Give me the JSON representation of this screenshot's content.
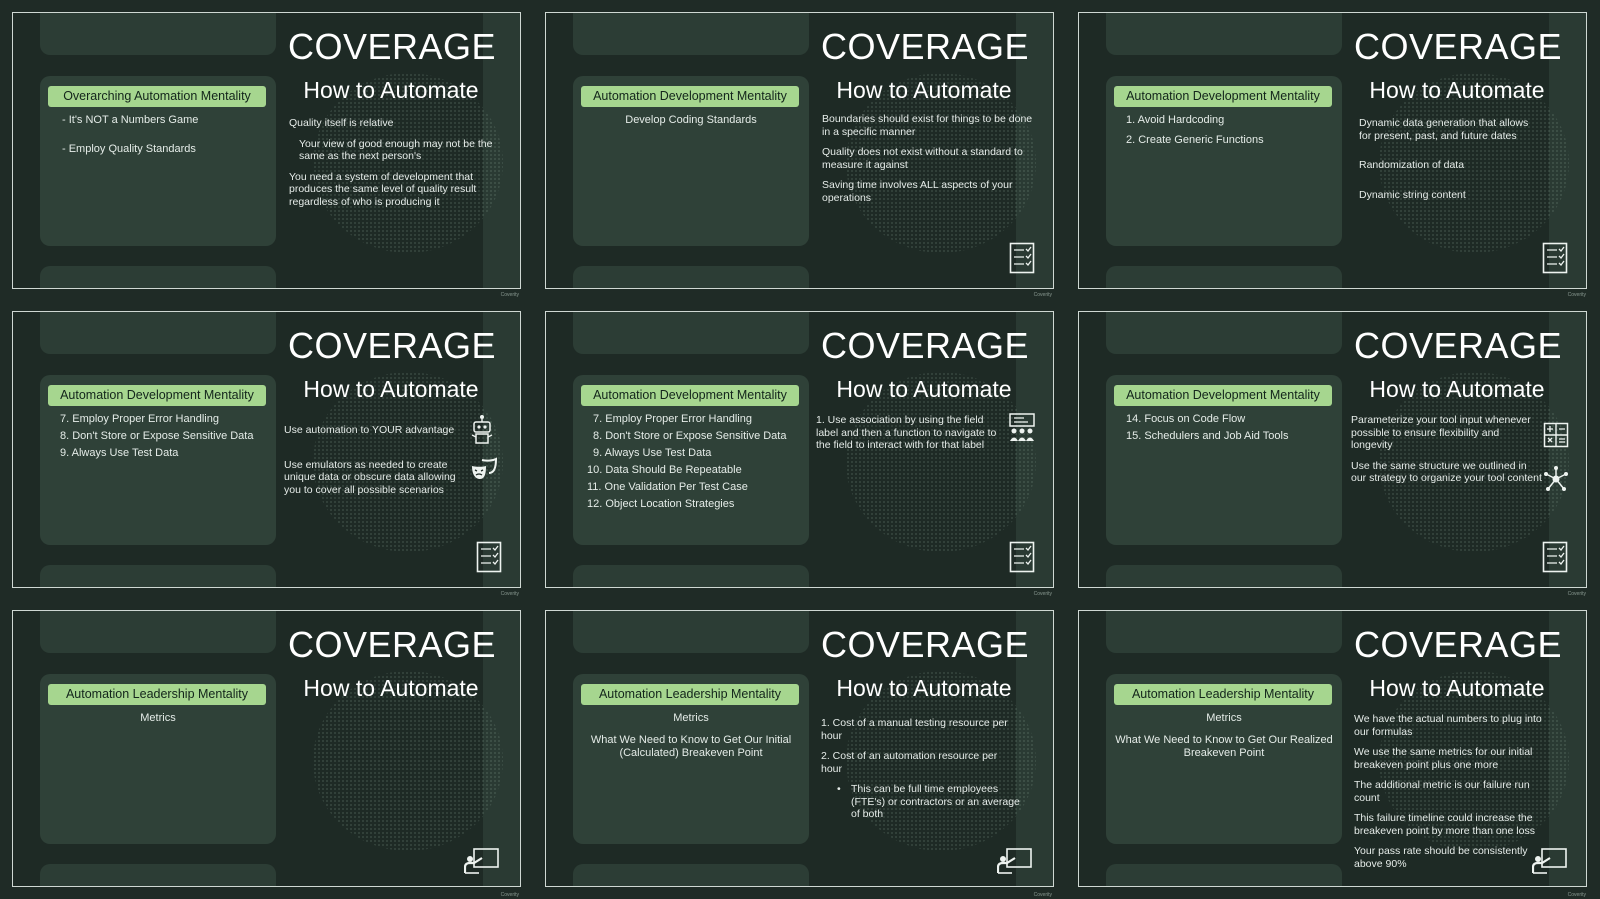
{
  "slides": [
    {
      "title": "COVERAGE",
      "subtitle": "How to Automate",
      "panel_label": "Overarching Automation Mentality",
      "panel_items": [
        "- It's NOT a Numbers Game",
        "- Employ Quality Standards"
      ],
      "right_text": [
        "Quality itself is relative",
        "Your view of good enough may not be the same as the next person's",
        "You need a system of development that produces the same level of quality result regardless of who is producing it"
      ],
      "corner_icon": "none",
      "watermark": "Coverity"
    },
    {
      "title": "COVERAGE",
      "subtitle": "How to Automate",
      "panel_label": "Automation Development Mentality",
      "panel_items": [
        "Develop Coding Standards"
      ],
      "right_text": [
        "Boundaries should exist for things to be done in a specific manner",
        "Quality does not exist without a standard to measure it against",
        "Saving time involves ALL aspects of your operations"
      ],
      "corner_icon": "checklist-icon",
      "watermark": "Coverity"
    },
    {
      "title": "COVERAGE",
      "subtitle": "How to Automate",
      "panel_label": "Automation Development Mentality",
      "panel_items": [
        "1. Avoid Hardcoding",
        "2. Create Generic Functions"
      ],
      "right_text": [
        "Dynamic data generation that allows for present, past, and future dates",
        "Randomization of data",
        "Dynamic string content"
      ],
      "corner_icon": "checklist-icon",
      "watermark": "Coverity"
    },
    {
      "title": "COVERAGE",
      "subtitle": "How to Automate",
      "panel_label": "Automation Development Mentality",
      "panel_items": [
        "7. Employ Proper Error Handling",
        "8. Don't Store or Expose Sensitive Data",
        "9. Always Use Test Data"
      ],
      "right_text": [
        "Use automation to YOUR advantage",
        "Use emulators as needed to create unique data or obscure data allowing you to cover all possible scenarios"
      ],
      "side_icons": [
        "robot-icon",
        "theater-masks-icon"
      ],
      "corner_icon": "checklist-icon",
      "watermark": "Coverity"
    },
    {
      "title": "COVERAGE",
      "subtitle": "How to Automate",
      "panel_label": "Automation Development Mentality",
      "panel_items": [
        "7. Employ Proper Error Handling",
        "8. Don't Store or Expose Sensitive Data",
        "9. Always Use Test Data",
        "10. Data Should Be Repeatable",
        "11. One Validation Per Test Case",
        "12. Object Location Strategies"
      ],
      "right_text": [
        "1. Use association by using the field label and then a function to navigate to the field to interact with for that label"
      ],
      "side_icons": [
        "presentation-group-icon"
      ],
      "corner_icon": "checklist-icon",
      "watermark": "Coverity"
    },
    {
      "title": "COVERAGE",
      "subtitle": "How to Automate",
      "panel_label": "Automation Development Mentality",
      "panel_items": [
        "14. Focus on Code Flow",
        "15. Schedulers and Job Aid Tools"
      ],
      "right_text": [
        "Parameterize your tool input whenever possible to ensure flexibility and longevity",
        "Use the same structure we outlined in our strategy to organize your tool content"
      ],
      "side_icons": [
        "calculator-icon",
        "hub-icon"
      ],
      "corner_icon": "checklist-icon",
      "watermark": "Coverity"
    },
    {
      "title": "COVERAGE",
      "subtitle": "How to Automate",
      "panel_label": "Automation Leadership Mentality",
      "panel_items": [
        "Metrics"
      ],
      "right_text": [],
      "corner_icon": "teacher-board-icon",
      "watermark": "Coverity"
    },
    {
      "title": "COVERAGE",
      "subtitle": "How to Automate",
      "panel_label": "Automation Leadership Mentality",
      "panel_items": [
        "Metrics",
        "What We Need to Know to Get Our Initial (Calculated) Breakeven Point"
      ],
      "right_text": [
        "1. Cost of a manual testing resource per hour",
        "2. Cost of an automation resource per hour",
        "This can be full time employees (FTE's) or contractors or an average of both"
      ],
      "corner_icon": "teacher-board-icon",
      "watermark": "Coverity"
    },
    {
      "title": "COVERAGE",
      "subtitle": "How to Automate",
      "panel_label": "Automation Leadership Mentality",
      "panel_items": [
        "Metrics",
        "What We Need to Know to Get Our Realized Breakeven Point"
      ],
      "right_text": [
        "We have the actual numbers to plug into our formulas",
        "We use the same metrics for our initial breakeven point plus one more",
        "The additional metric is our failure run count",
        "This failure timeline could increase the breakeven point by more than one loss",
        "Your pass rate should be consistently above 90%"
      ],
      "corner_icon": "teacher-board-icon",
      "watermark": "Coverity"
    }
  ]
}
